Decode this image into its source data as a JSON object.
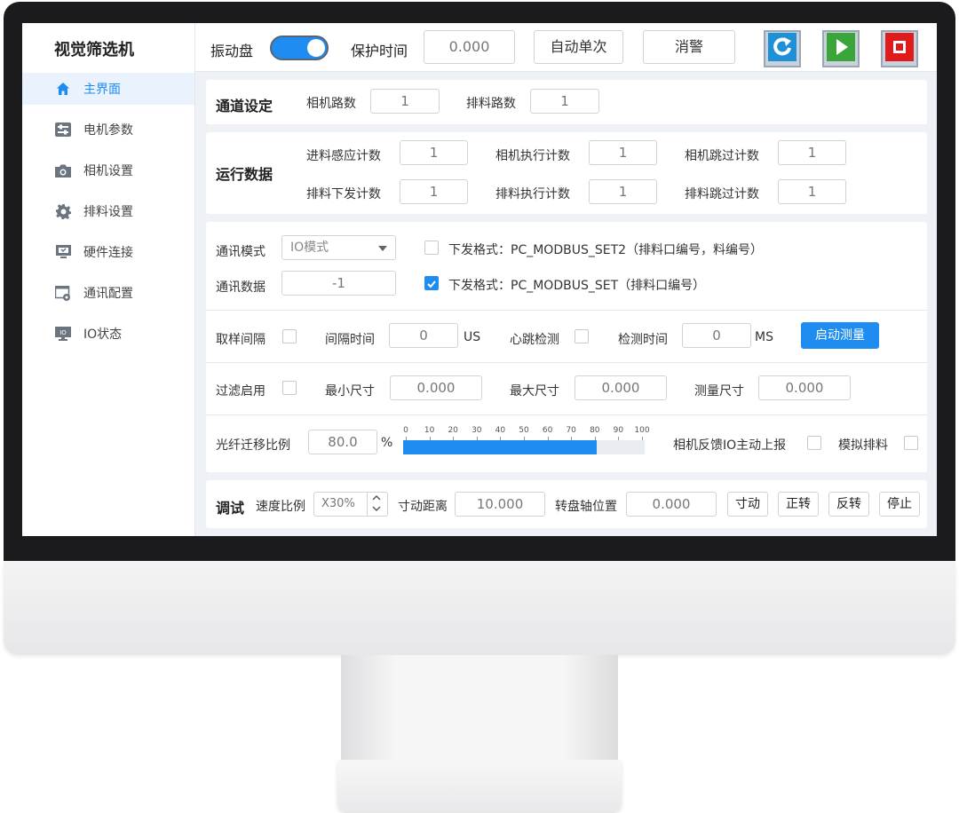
{
  "app": {
    "title": "视觉筛选机"
  },
  "sidebar": {
    "items": [
      {
        "label": "主界面",
        "icon": "home-icon",
        "active": true
      },
      {
        "label": "电机参数",
        "icon": "sliders-icon"
      },
      {
        "label": "相机设置",
        "icon": "camera-icon"
      },
      {
        "label": "排料设置",
        "icon": "gear-icon"
      },
      {
        "label": "硬件连接",
        "icon": "hardware-icon"
      },
      {
        "label": "通讯配置",
        "icon": "communication-icon"
      },
      {
        "label": "IO状态",
        "icon": "io-icon"
      }
    ]
  },
  "topbar": {
    "vibration_label": "振动盘",
    "vibration_on": true,
    "protect_label": "保护时间",
    "protect_value": "0.000",
    "auto_once_label": "自动单次",
    "clear_alarm_label": "消警",
    "tools": [
      {
        "icon": "refresh-icon",
        "color": "#1e90d8"
      },
      {
        "icon": "play-icon",
        "color": "#3aa63a"
      },
      {
        "icon": "stop-icon",
        "color": "#e01b1b"
      }
    ]
  },
  "channel": {
    "title": "通道设定",
    "camera_count_label": "相机路数",
    "camera_count": "1",
    "discharge_count_label": "排料路数",
    "discharge_count": "1"
  },
  "runtime": {
    "title": "运行数据",
    "row1": [
      {
        "label": "进料感应计数",
        "value": "1"
      },
      {
        "label": "相机执行计数",
        "value": "1"
      },
      {
        "label": "相机跳过计数",
        "value": "1"
      }
    ],
    "row2": [
      {
        "label": "排料下发计数",
        "value": "1"
      },
      {
        "label": "排料执行计数",
        "value": "1"
      },
      {
        "label": "排料跳过计数",
        "value": "1"
      }
    ]
  },
  "comm": {
    "mode_label": "通讯模式",
    "mode_value": "IO模式",
    "data_label": "通讯数据",
    "data_value": "-1",
    "format1_label": "下发格式：PC_MODBUS_SET2（排料口编号，料编号）",
    "format1_checked": false,
    "format2_label": "下发格式：PC_MODBUS_SET（排料口编号）",
    "format2_checked": true
  },
  "sampling": {
    "interval_enable_label": "取样间隔",
    "interval_time_label": "间隔时间",
    "interval_time_value": "0",
    "interval_unit": "US",
    "heartbeat_label": "心跳检测",
    "detect_time_label": "检测时间",
    "detect_time_value": "0",
    "detect_unit": "MS",
    "start_measure_label": "启动测量"
  },
  "filter": {
    "enable_label": "过滤启用",
    "min_label": "最小尺寸",
    "min_value": "0.000",
    "max_label": "最大尺寸",
    "max_value": "0.000",
    "measure_label": "测量尺寸",
    "measure_value": "0.000"
  },
  "fiber": {
    "ratio_label": "光纤迁移比例",
    "ratio_value": "80.0",
    "ratio_unit": "%",
    "progress_percent": 80,
    "scale_ticks": [
      "0",
      "10",
      "20",
      "30",
      "40",
      "50",
      "60",
      "70",
      "80",
      "90",
      "100"
    ],
    "camera_feedback_label": "相机反馈IO主动上报",
    "simulate_label": "模拟排料"
  },
  "debug": {
    "title": "调试",
    "speed_label": "速度比例",
    "speed_value": "X30%",
    "jog_distance_label": "寸动距离",
    "jog_distance_value": "10.000",
    "turntable_label": "转盘轴位置",
    "turntable_value": "0.000",
    "jog_label": "寸动",
    "forward_label": "正转",
    "reverse_label": "反转",
    "stop_label": "停止"
  }
}
